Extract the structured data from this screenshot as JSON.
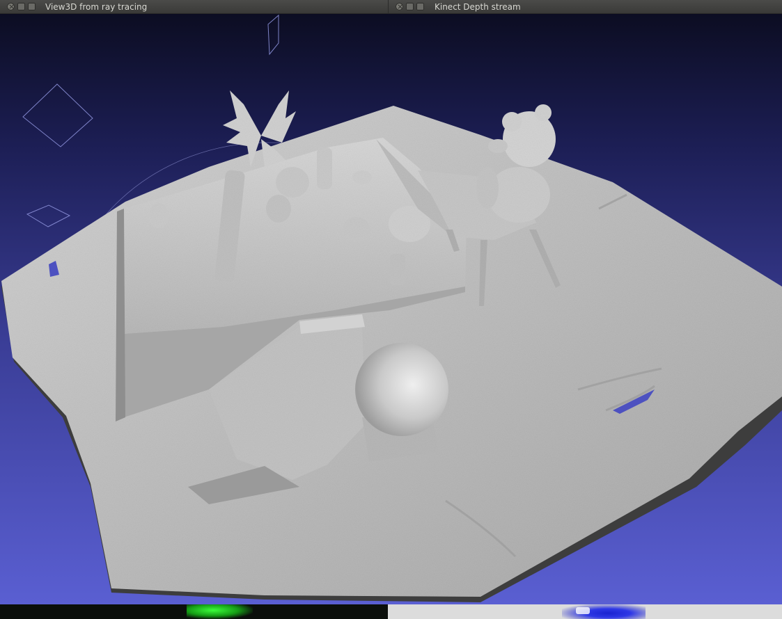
{
  "windows": {
    "left": {
      "title": "View3D from ray tracing"
    },
    "right": {
      "title": "Kinect Depth stream"
    }
  },
  "colors": {
    "background_top": "#0c0d22",
    "background_bottom": "#5a5fd2",
    "mesh": "#c4c4c4",
    "titlebar": "#41413f"
  },
  "icons": [
    "close-icon",
    "minimize-icon",
    "maximize-icon"
  ]
}
